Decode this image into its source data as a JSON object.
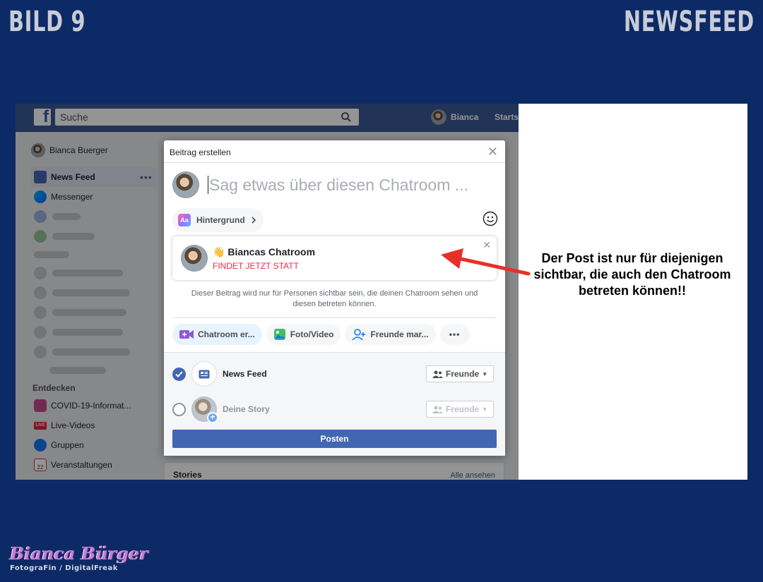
{
  "slide": {
    "left_title": "BILD 9",
    "right_title": "NEWSFEED"
  },
  "fb": {
    "search_placeholder": "Suche",
    "user_name": "Bianca",
    "home_label": "Startse"
  },
  "sidebar": {
    "profile_name": "Bianca Buerger",
    "items": [
      {
        "label": "News Feed",
        "icon": "news-feed-icon"
      },
      {
        "label": "Messenger",
        "icon": "messenger-icon"
      }
    ],
    "discover_heading": "Entdecken",
    "discover_items": [
      {
        "label": "COVID-19-Informat...",
        "icon": "shield-heart-icon"
      },
      {
        "label": "Live-Videos",
        "icon": "live-icon",
        "badge": "LIVE"
      },
      {
        "label": "Gruppen",
        "icon": "groups-icon"
      },
      {
        "label": "Veranstaltungen",
        "icon": "calendar-icon",
        "badge": "22"
      }
    ]
  },
  "stories": {
    "title": "Stories",
    "see_all": "Alle ansehen"
  },
  "modal": {
    "title": "Beitrag erstellen",
    "composer_placeholder": "Sag etwas über diesen Chatroom ...",
    "background_button": "Hintergrund",
    "background_icon_text": "Aa",
    "room": {
      "emoji": "👋",
      "name": "Biancas Chatroom",
      "status": "FINDET JETZT STATT"
    },
    "notice": "Dieser Beitrag wird nur für Personen sichtbar sein, die deinen Chatroom sehen und diesen betreten können.",
    "actions": [
      {
        "label": "Chatroom er...",
        "icon": "video-plus-icon"
      },
      {
        "label": "Foto/Video",
        "icon": "photo-icon"
      },
      {
        "label": "Freunde mar...",
        "icon": "tag-friends-icon"
      }
    ],
    "more_label": "•••",
    "destinations": [
      {
        "label": "News Feed",
        "checked": true,
        "audience": "Freunde"
      },
      {
        "label": "Deine Story",
        "checked": false,
        "audience": "Freunde"
      }
    ],
    "post_button": "Posten"
  },
  "annotation": "Der Post ist nur für diejenigen sichtbar, die auch den Chatroom betreten können!!",
  "logo": {
    "line1": "Bianca Bürger",
    "line2": "FotograFin / DigitalFreak"
  },
  "colors": {
    "background": "#0c2a66",
    "facebook_blue": "#3b5998",
    "post_button": "#4267b2",
    "live_status": "#f02849",
    "arrow": "#e8302a"
  }
}
